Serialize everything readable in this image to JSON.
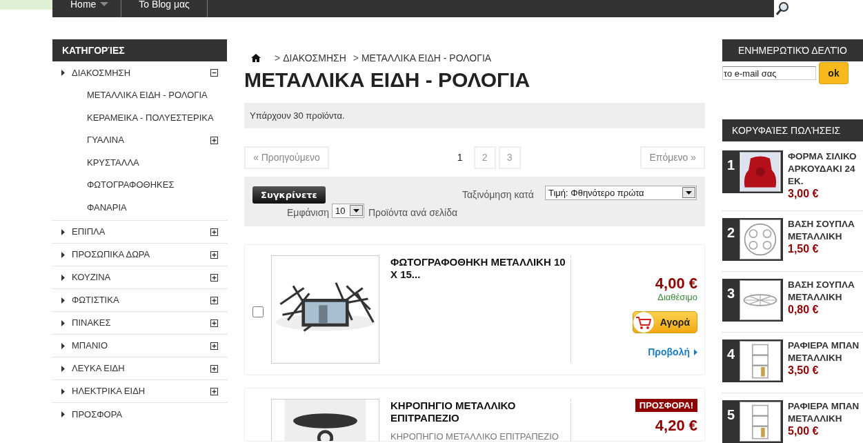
{
  "nav": {
    "items": [
      {
        "label": "Home",
        "has_menu": true
      },
      {
        "label": "Το Blog μας",
        "has_menu": false
      }
    ]
  },
  "categories": {
    "title": "ΚΑΤΗΓΟΡΊΕΣ",
    "items": [
      {
        "label": "ΔΙΑΚΟΣΜΗΣΗ",
        "kind": "branch",
        "expanded": true,
        "children": [
          {
            "label": "ΜΕΤΑΛΛΙΚΑ ΕΙΔΗ - ΡΟΛΟΓΙΑ",
            "kind": "leaf"
          },
          {
            "label": "ΚΕΡΑΜΕΙΚΑ - ΠΟΛΥΕΣΤΕΡΙΚΑ",
            "kind": "leaf"
          },
          {
            "label": "ΓΥΑΛΙΝΑ",
            "kind": "branch",
            "expanded": false
          },
          {
            "label": "ΚΡΥΣΤΑΛΛΑ",
            "kind": "leaf"
          },
          {
            "label": "ΦΩΤΟΓΡΑΦΟΘΗΚΕΣ",
            "kind": "leaf"
          },
          {
            "label": "ΦΑΝΑΡΙΑ",
            "kind": "leaf"
          }
        ]
      },
      {
        "label": "ΕΠΙΠΛΑ",
        "kind": "branch",
        "expanded": false
      },
      {
        "label": "ΠΡΟΣΩΠΙΚΑ ΔΩΡΑ",
        "kind": "branch",
        "expanded": false
      },
      {
        "label": "ΚΟΥΖΙΝΑ",
        "kind": "branch",
        "expanded": false
      },
      {
        "label": "ΦΩΤΙΣΤΙΚΑ",
        "kind": "branch",
        "expanded": false
      },
      {
        "label": "ΠΙΝΑΚΕΣ",
        "kind": "branch",
        "expanded": false
      },
      {
        "label": "ΜΠΑΝΙΟ",
        "kind": "branch",
        "expanded": false
      },
      {
        "label": "ΛΕΥΚΑ ΕΙΔΗ",
        "kind": "branch",
        "expanded": false
      },
      {
        "label": "ΗΛΕΚΤΡΙΚΑ ΕΙΔΗ",
        "kind": "branch",
        "expanded": false
      },
      {
        "label": "ΠΡΟΣΦΟΡΑ",
        "kind": "leaf"
      }
    ]
  },
  "breadcrumb": [
    ">",
    "ΔΙΑΚΟΣΜΗΣΗ",
    ">",
    "ΜΕΤΑΛΛΙΚΑ ΕΙΔΗ - ΡΟΛΟΓΙΑ"
  ],
  "heading": "ΜΕΤΑΛΛΙΚΑ ΕΙΔΗ - ΡΟΛΟΓΙΑ",
  "count_text": "Υπάρχουν 30 προϊόντα.",
  "pagination": {
    "previous": "« Προηγούμενο",
    "next": "Επόμενο »",
    "pages": [
      {
        "label": "1",
        "selected": true
      },
      {
        "label": "2",
        "selected": false
      },
      {
        "label": "3",
        "selected": false
      }
    ]
  },
  "toolbar": {
    "compare": "Συγκρίνετε",
    "sort_label": "Ταξινόμηση κατά",
    "sort_value": "Τιμή: Φθηνότερο πρώτα",
    "show_label": "Εμφάνιση",
    "per_page": "10",
    "per_page_suffix": "Προϊόντα ανά σελίδα"
  },
  "products": [
    {
      "title": "ΦΩΤΟΓΡΑΦΟΘΗΚΗ ΜΕΤΑΛΛΙΚΗ 10 Χ 15...",
      "price": "4,00 €",
      "availability": "Διαθέσιμο",
      "buy": "Αγορά",
      "view": "Προβολή",
      "checked": false
    },
    {
      "title": "ΚΗΡΟΠΗΓΙΟ ΜΕΤΑΛΛΙΚΟ ΕΠΙΤΡΑΠΕΖΙΟ",
      "badge": "ΠΡΟΣΦΟΡΑ!",
      "price": "4,20 €",
      "description": "ΚΗΡΟΠΗΓΙΟ ΜΕΤΑΛΛΙΚΟ ΕΠΙΤΡΑΠΕΖΙΟ"
    }
  ],
  "newsletter": {
    "title": "ΕΝΗΜΕΡΩΤΙΚΌ ΔΕΛΤΊΟ",
    "placeholder": "το e-mail σας",
    "button": "ok"
  },
  "top_sellers": {
    "title": "ΚΟΡΥΦΑΊΕΣ ΠΩΛΉΣΕΙΣ",
    "items": [
      {
        "rank": "1",
        "name": "ΦΟΡΜΑ ΣΙΛΙΚΟ ΑΡΚΟΥΔΑΚΙ 24 ΕΚ.",
        "price": "3,00 €"
      },
      {
        "rank": "2",
        "name": "ΒΑΣΗ ΣΟΥΠΛΑ ΜΕΤΑΛΛΙΚΗ",
        "price": "1,50 €"
      },
      {
        "rank": "3",
        "name": "ΒΑΣΗ ΣΟΥΠΛΑ ΜΕΤΑΛΛΙΚΗ",
        "price": "0,80 €"
      },
      {
        "rank": "4",
        "name": "ΡΑΦΙΕΡΑ ΜΠΑΝ ΜΕΤΑΛΛΙΚΗ",
        "price": "3,50 €"
      },
      {
        "rank": "5",
        "name": "ΡΑΦΙΕΡΑ ΜΠΑΝ ΜΕΤΑΛΛΙΚΗ",
        "price": "5,00 €"
      }
    ]
  }
}
